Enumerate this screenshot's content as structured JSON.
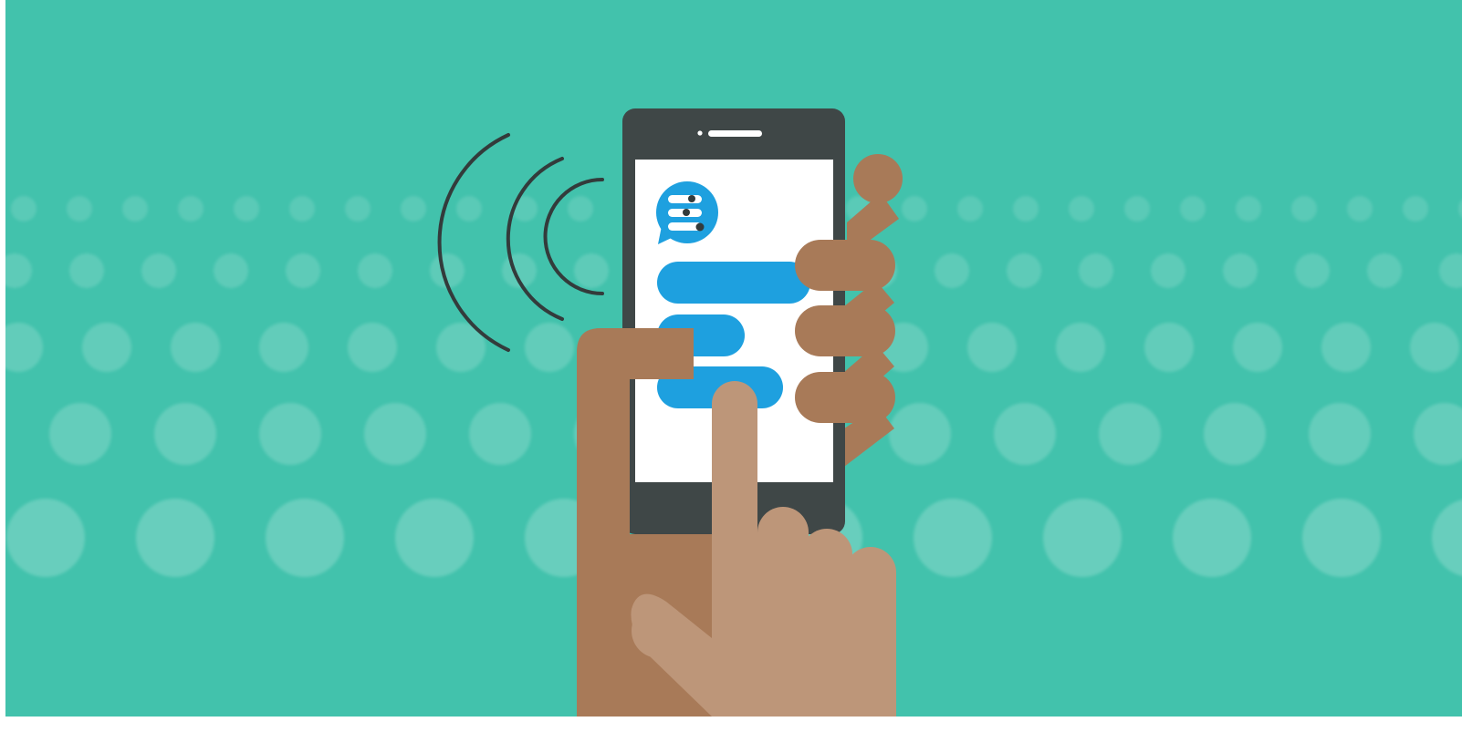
{
  "scene": {
    "kind": "flat illustration",
    "colors": {
      "background": "#42c2ac",
      "dot": "#ffffff",
      "phone_body": "#3f4747",
      "screen": "#ffffff",
      "message_bubble": "#1ea0df",
      "holding_hand": "#a87a58",
      "pointing_hand": "#bd9679",
      "signal_arc": "#333b3b",
      "border": "#ffffff"
    },
    "icons": [
      "phone",
      "chat-icon",
      "signal-arcs",
      "holding-hand",
      "pointing-hand"
    ],
    "message_bubble_count": 3,
    "signal_arc_count": 3
  }
}
